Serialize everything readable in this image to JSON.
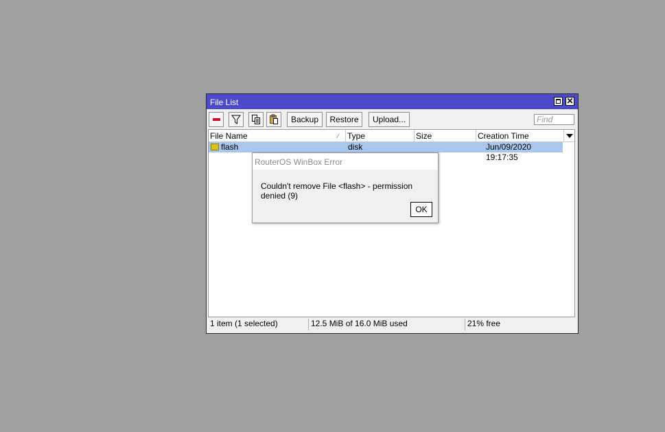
{
  "window": {
    "title": "File List"
  },
  "toolbar": {
    "backup_label": "Backup",
    "restore_label": "Restore",
    "upload_label": "Upload...",
    "find_placeholder": "Find"
  },
  "table": {
    "columns": [
      "File Name",
      "Type",
      "Size",
      "Creation Time"
    ],
    "rows": [
      {
        "name": "flash",
        "type": "disk",
        "size": "",
        "creation_time": "Jun/09/2020 19:17:35",
        "selected": true
      }
    ]
  },
  "status": {
    "items": "1 item (1 selected)",
    "usage": "12.5 MiB of 16.0 MiB used",
    "free": "21% free"
  },
  "dialog": {
    "title": "RouterOS WinBox Error",
    "message": "Couldn't remove File <flash> - permission denied (9)",
    "ok_label": "OK"
  },
  "colors": {
    "titlebar": "#4b4bc9",
    "selection": "#a9c6ec",
    "desktop": "#a0a0a0",
    "remove_icon": "#c8102e"
  },
  "icons": [
    "remove-icon",
    "filter-icon",
    "copy-icon",
    "paste-icon",
    "maximize-icon",
    "close-icon",
    "folder-icon",
    "column-dropdown-icon"
  ]
}
